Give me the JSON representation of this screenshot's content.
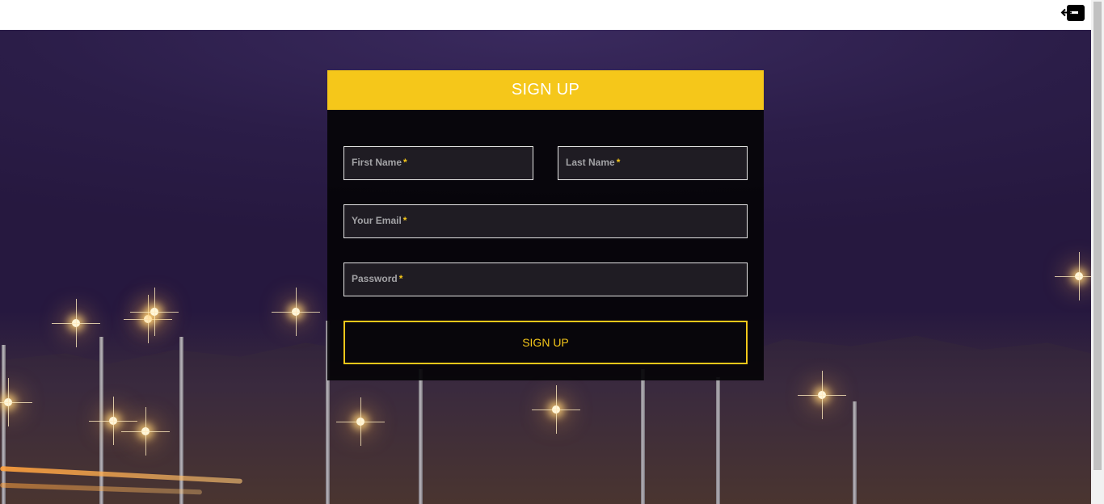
{
  "topbar": {
    "logout_icon": "logout-icon"
  },
  "form": {
    "title": "SIGN UP",
    "fields": {
      "first_name": {
        "placeholder": "First Name",
        "required_mark": "*"
      },
      "last_name": {
        "placeholder": "Last Name",
        "required_mark": "*"
      },
      "email": {
        "placeholder": "Your Email",
        "required_mark": "*"
      },
      "password": {
        "placeholder": "Password",
        "required_mark": "*"
      }
    },
    "submit_label": "SIGN UP"
  },
  "colors": {
    "accent": "#f5c71a",
    "card_background": "#050408",
    "field_border": "#e6e6e6"
  }
}
